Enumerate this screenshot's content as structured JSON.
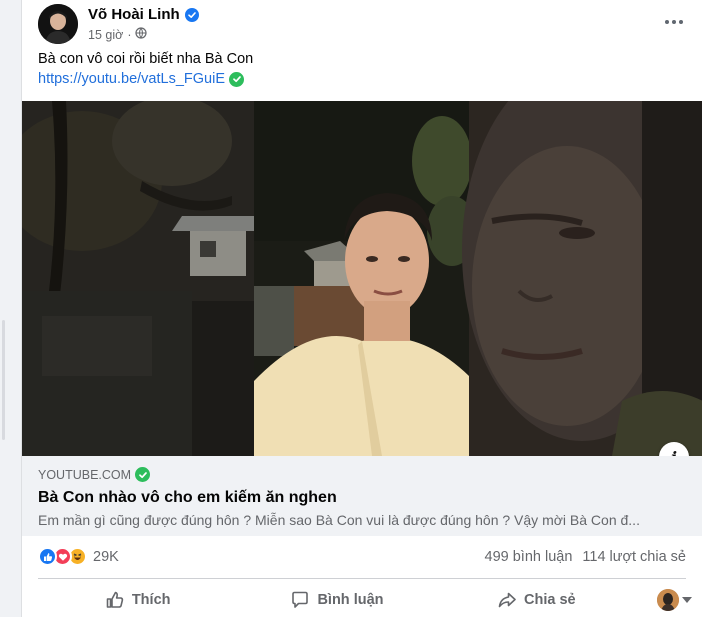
{
  "post": {
    "author": "Võ Hoài Linh",
    "time": "15 giờ",
    "text": "Bà con vô coi rồi biết nha Bà Con",
    "link": "https://youtu.be/vatLs_FGuiE"
  },
  "preview": {
    "domain": "YOUTUBE.COM",
    "title": "Bà Con nhào vô cho em kiếm ăn nghen",
    "description": "Em mần gì cũng được đúng hôn ? Miễn sao Bà Con vui là được đúng hôn ? Vậy mời Bà Con đ..."
  },
  "stats": {
    "reaction_count": "29K",
    "comments": "499 bình luận",
    "shares": "114 lượt chia sẻ"
  },
  "actions": {
    "like": "Thích",
    "comment": "Bình luận",
    "share": "Chia sẻ"
  },
  "icons": [
    "verified-icon",
    "globe-icon",
    "more-icon",
    "check-icon",
    "info-icon",
    "like-reaction-icon",
    "love-reaction-icon",
    "haha-reaction-icon",
    "thumbs-up-icon",
    "comment-icon",
    "share-icon",
    "caret-down-icon"
  ],
  "colors": {
    "link": "#216fdb",
    "verified": "#1877f2",
    "check": "#2dbd5c",
    "secondary_text": "#65676b"
  }
}
